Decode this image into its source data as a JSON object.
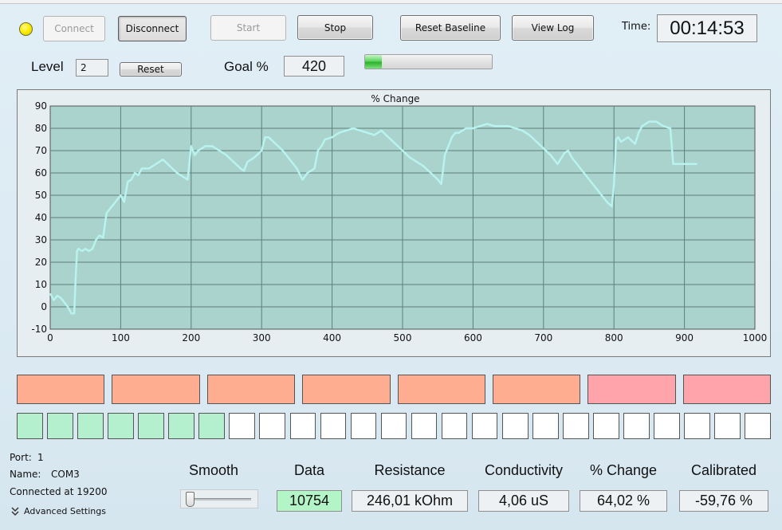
{
  "toolbar": {
    "connect_label": "Connect",
    "disconnect_label": "Disconnect",
    "start_label": "Start",
    "stop_label": "Stop",
    "reset_baseline_label": "Reset Baseline",
    "view_log_label": "View Log",
    "time_label": "Time:",
    "time_value": "00:14:53"
  },
  "level": {
    "label": "Level",
    "value": "2",
    "reset_label": "Reset"
  },
  "goal": {
    "label": "Goal %",
    "value": "420",
    "progress_fraction": 0.13,
    "progress_color": "#3cc43c"
  },
  "chart_data": {
    "type": "line",
    "title": "% Change",
    "xlabel": "",
    "ylabel": "",
    "xlim": [
      0,
      1000
    ],
    "ylim": [
      -10,
      90
    ],
    "x_ticks": [
      0,
      100,
      200,
      300,
      400,
      500,
      600,
      700,
      800,
      900,
      1000
    ],
    "y_ticks": [
      -10,
      0,
      10,
      20,
      30,
      40,
      50,
      60,
      70,
      80,
      90
    ],
    "grid": true,
    "plot_background": "#a9d3cc",
    "line_color": "#b9f3ef",
    "series": [
      {
        "x": [
          0,
          5,
          10,
          15,
          20,
          25,
          30,
          34,
          36,
          38,
          40,
          45,
          50,
          55,
          60,
          65,
          70,
          75,
          80,
          85,
          90,
          95,
          100,
          105,
          110,
          115,
          120,
          125,
          130,
          140,
          150,
          160,
          170,
          180,
          190,
          195,
          200,
          205,
          210,
          220,
          230,
          240,
          250,
          260,
          270,
          275,
          280,
          290,
          300,
          305,
          310,
          320,
          330,
          340,
          350,
          358,
          365,
          375,
          380,
          385,
          390,
          400,
          410,
          420,
          430,
          440,
          450,
          460,
          470,
          480,
          490,
          500,
          510,
          520,
          530,
          540,
          550,
          555,
          560,
          570,
          575,
          580,
          590,
          600,
          610,
          620,
          630,
          640,
          650,
          660,
          670,
          680,
          690,
          700,
          710,
          720,
          730,
          735,
          740,
          750,
          760,
          770,
          780,
          790,
          797,
          800,
          803,
          806,
          810,
          820,
          830,
          835,
          840,
          850,
          860,
          870,
          880,
          884,
          890,
          900,
          910,
          918
        ],
        "y": [
          6,
          3,
          5,
          4,
          2,
          0,
          -3,
          -3,
          12,
          25,
          26,
          25,
          26,
          25,
          26,
          30,
          32,
          31,
          42,
          44,
          46,
          48,
          50,
          47,
          56,
          57,
          60,
          59,
          62,
          62,
          64,
          66,
          63,
          60,
          58,
          57,
          72,
          68,
          70,
          72,
          72,
          70,
          68,
          65,
          62,
          61,
          65,
          67,
          70,
          76,
          76,
          73,
          70,
          66,
          62,
          57,
          60,
          62,
          70,
          72,
          75,
          76,
          78,
          79,
          80,
          79,
          78,
          77,
          79,
          76,
          73,
          70,
          67,
          65,
          63,
          60,
          57,
          55,
          68,
          76,
          78,
          78,
          80,
          80,
          81,
          82,
          81,
          81,
          81,
          80,
          79,
          77,
          74,
          71,
          68,
          64,
          69,
          70,
          67,
          63,
          59,
          55,
          51,
          47,
          45,
          55,
          75,
          76,
          74,
          76,
          73,
          78,
          81,
          83,
          83,
          81,
          80,
          64,
          64,
          64,
          64,
          64
        ]
      }
    ]
  },
  "tiles": {
    "top_row": [
      "#ffad91",
      "#ffad91",
      "#ffad91",
      "#ffad91",
      "#ffad91",
      "#ffad91",
      "#ffa4aa",
      "#ffa4aa"
    ],
    "bottom_filled_count": 7,
    "bottom_total": 25,
    "bottom_fill_color": "#b4f0cd",
    "bottom_empty_color": "#ffffff"
  },
  "connection": {
    "port_label": "Port:",
    "port_value": "1",
    "name_label": "Name:",
    "name_value": "COM3",
    "status": "Connected at 19200",
    "advanced_label": "Advanced Settings"
  },
  "readouts": {
    "smooth_label": "Smooth",
    "smooth_level": 0.0,
    "data_label": "Data",
    "data_value": "10754",
    "data_bg": "#b4f5c8",
    "resistance_label": "Resistance",
    "resistance_value": "246,01 kOhm",
    "conductivity_label": "Conductivity",
    "conductivity_value": "4,06 uS",
    "pct_change_label": "% Change",
    "pct_change_value": "64,02 %",
    "calibrated_label": "Calibrated",
    "calibrated_value": "-59,76 %"
  }
}
